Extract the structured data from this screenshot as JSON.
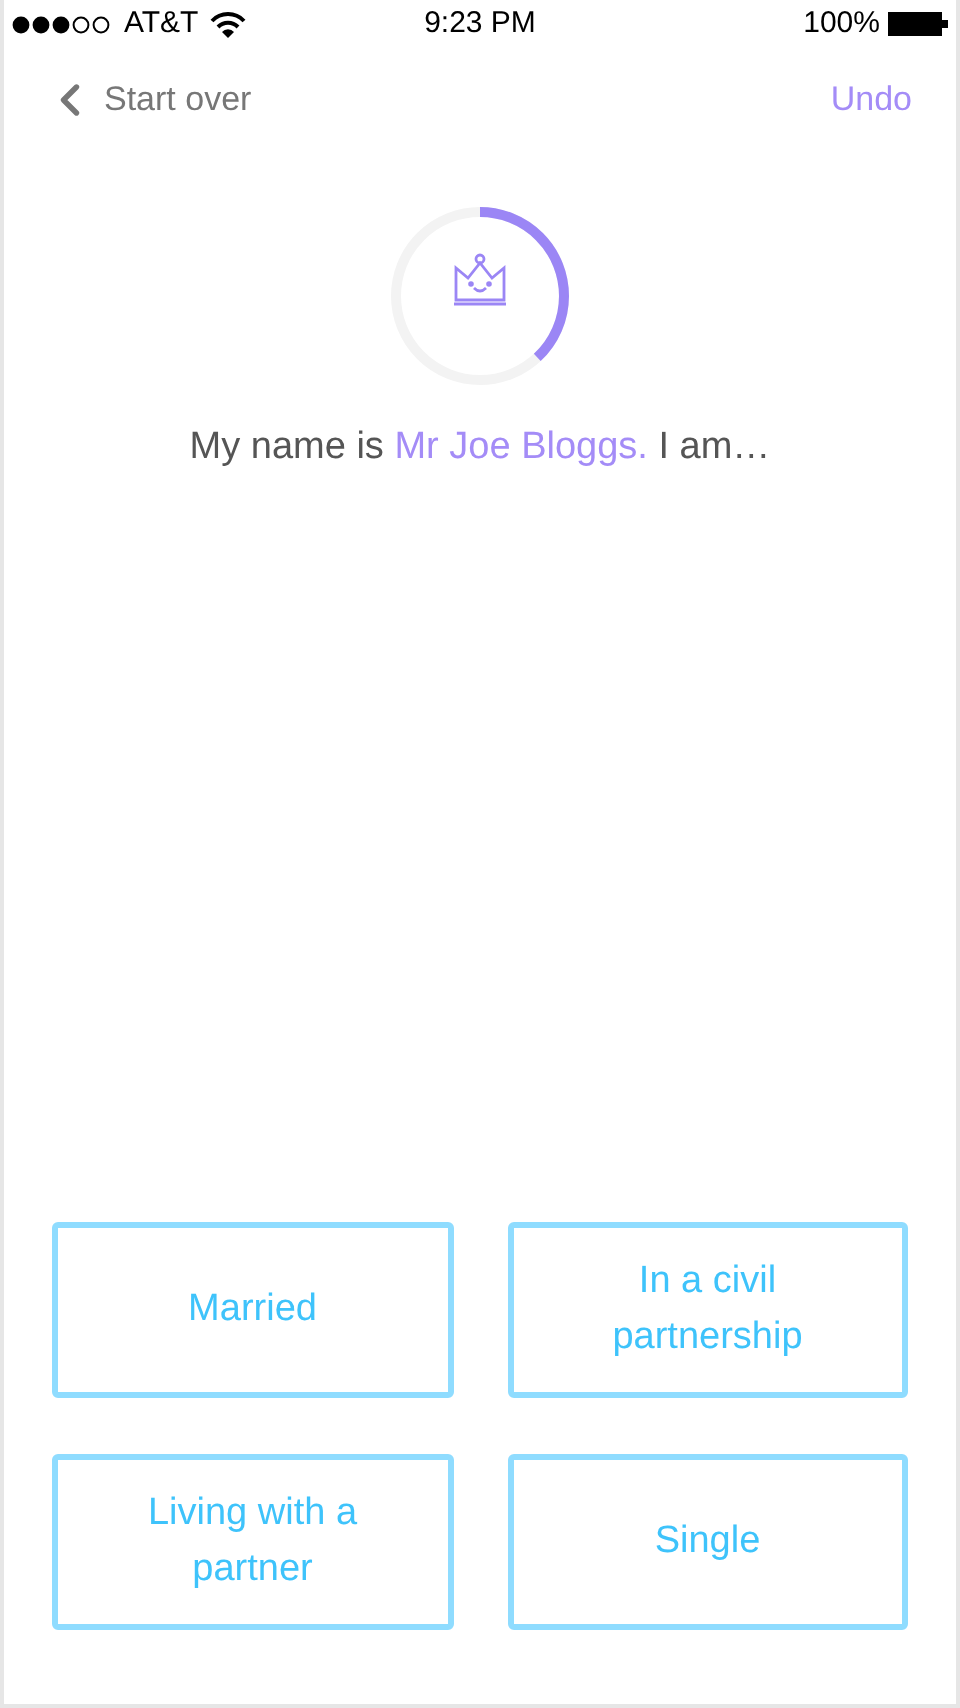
{
  "status_bar": {
    "carrier": "AT&T",
    "time": "9:23 PM",
    "battery": "100%"
  },
  "nav": {
    "back": "Start over",
    "undo": "Undo"
  },
  "progress": {
    "level": 0.38
  },
  "prompt": {
    "prefix": "My name is ",
    "name": "Mr Joe Bloggs.",
    "suffix": " I am…"
  },
  "options": [
    {
      "label": "Married"
    },
    {
      "label": "In a civil partnership"
    },
    {
      "label": "Living with a partner"
    },
    {
      "label": "Single"
    }
  ]
}
